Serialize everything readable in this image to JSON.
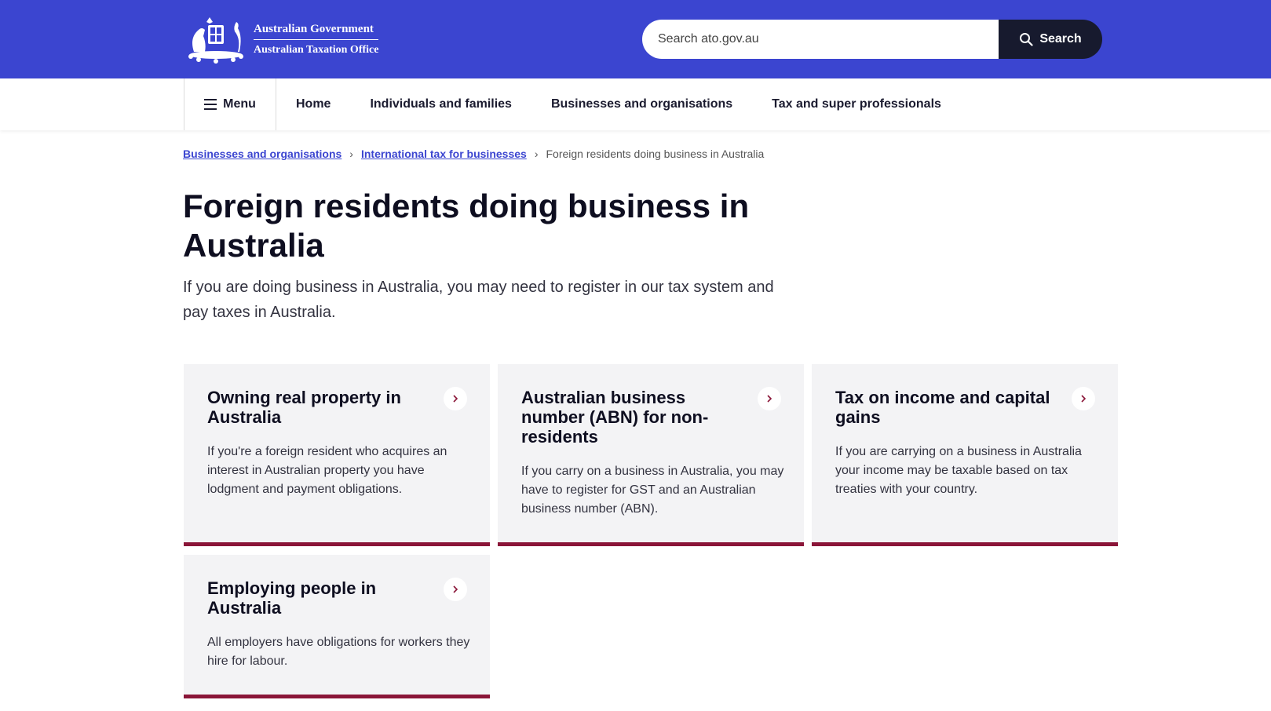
{
  "header": {
    "logo_line1": "Australian Government",
    "logo_line2": "Australian Taxation Office",
    "search_placeholder": "Search ato.gov.au",
    "search_button": "Search",
    "colors": {
      "brand_blue": "#3b45d0",
      "dark": "#171a2e"
    }
  },
  "nav": {
    "menu_label": "Menu",
    "links": [
      "Home",
      "Individuals and families",
      "Businesses and organisations",
      "Tax and super professionals"
    ]
  },
  "breadcrumb": {
    "items": [
      "Businesses and organisations",
      "International tax for businesses"
    ],
    "current": "Foreign residents doing business in Australia"
  },
  "page": {
    "title": "Foreign residents doing business in Australia",
    "intro": "If you are doing business in Australia, you may need to register in our tax system and pay taxes in Australia."
  },
  "cards": [
    {
      "title": "Owning real property in Australia",
      "desc": "If you're a foreign resident who acquires an interest in Australian property you have lodgment and payment obligations."
    },
    {
      "title": "Australian business number (ABN) for non-residents",
      "desc": "If you carry on a business in Australia, you may have to register for GST and an Australian business number (ABN)."
    },
    {
      "title": "Tax on income and capital gains",
      "desc": "If you are carrying on a business in Australia your income may be taxable based on tax treaties with your country."
    },
    {
      "title": "Employing people in Australia",
      "desc": "All employers have obligations for workers they hire for labour."
    }
  ],
  "accent_color": "#8a1538"
}
